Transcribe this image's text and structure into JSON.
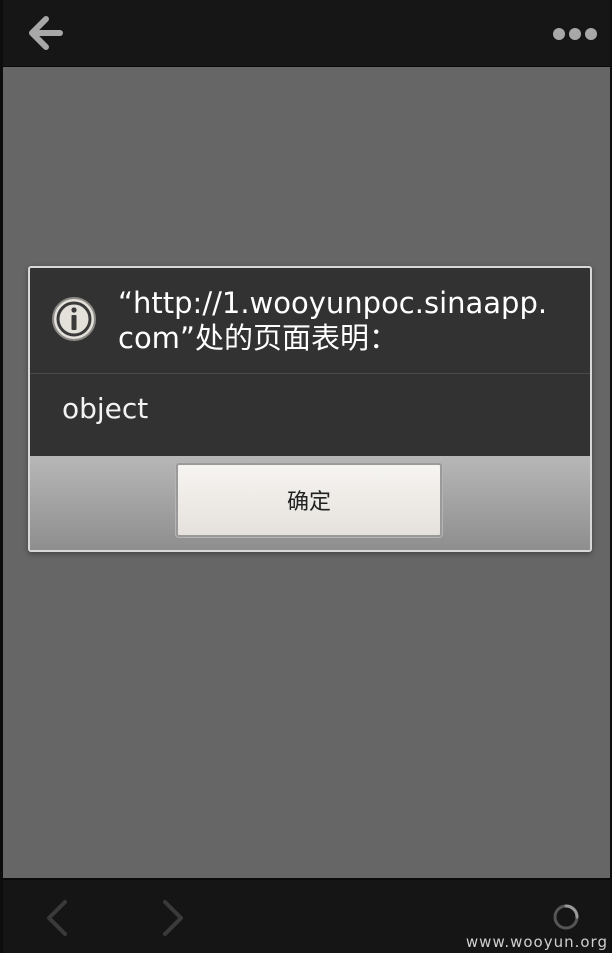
{
  "top_bar": {
    "back_icon": "arrow-left-icon",
    "menu_icon": "more-dots-icon"
  },
  "dialog": {
    "icon": "info-icon",
    "title": "“http://1.wooyunpoc.sinaapp.com”处的页面表明：",
    "message": "object",
    "ok_label": "确定"
  },
  "bottom_bar": {
    "back_icon": "chevron-left-icon",
    "forward_icon": "chevron-right-icon",
    "loading_icon": "loading-spinner-icon"
  },
  "watermark": "www.wooyun.org",
  "colors": {
    "page_background": "#666666",
    "bar_background": "#161616",
    "dialog_background": "#323232",
    "button_background": "#eeeae6"
  }
}
